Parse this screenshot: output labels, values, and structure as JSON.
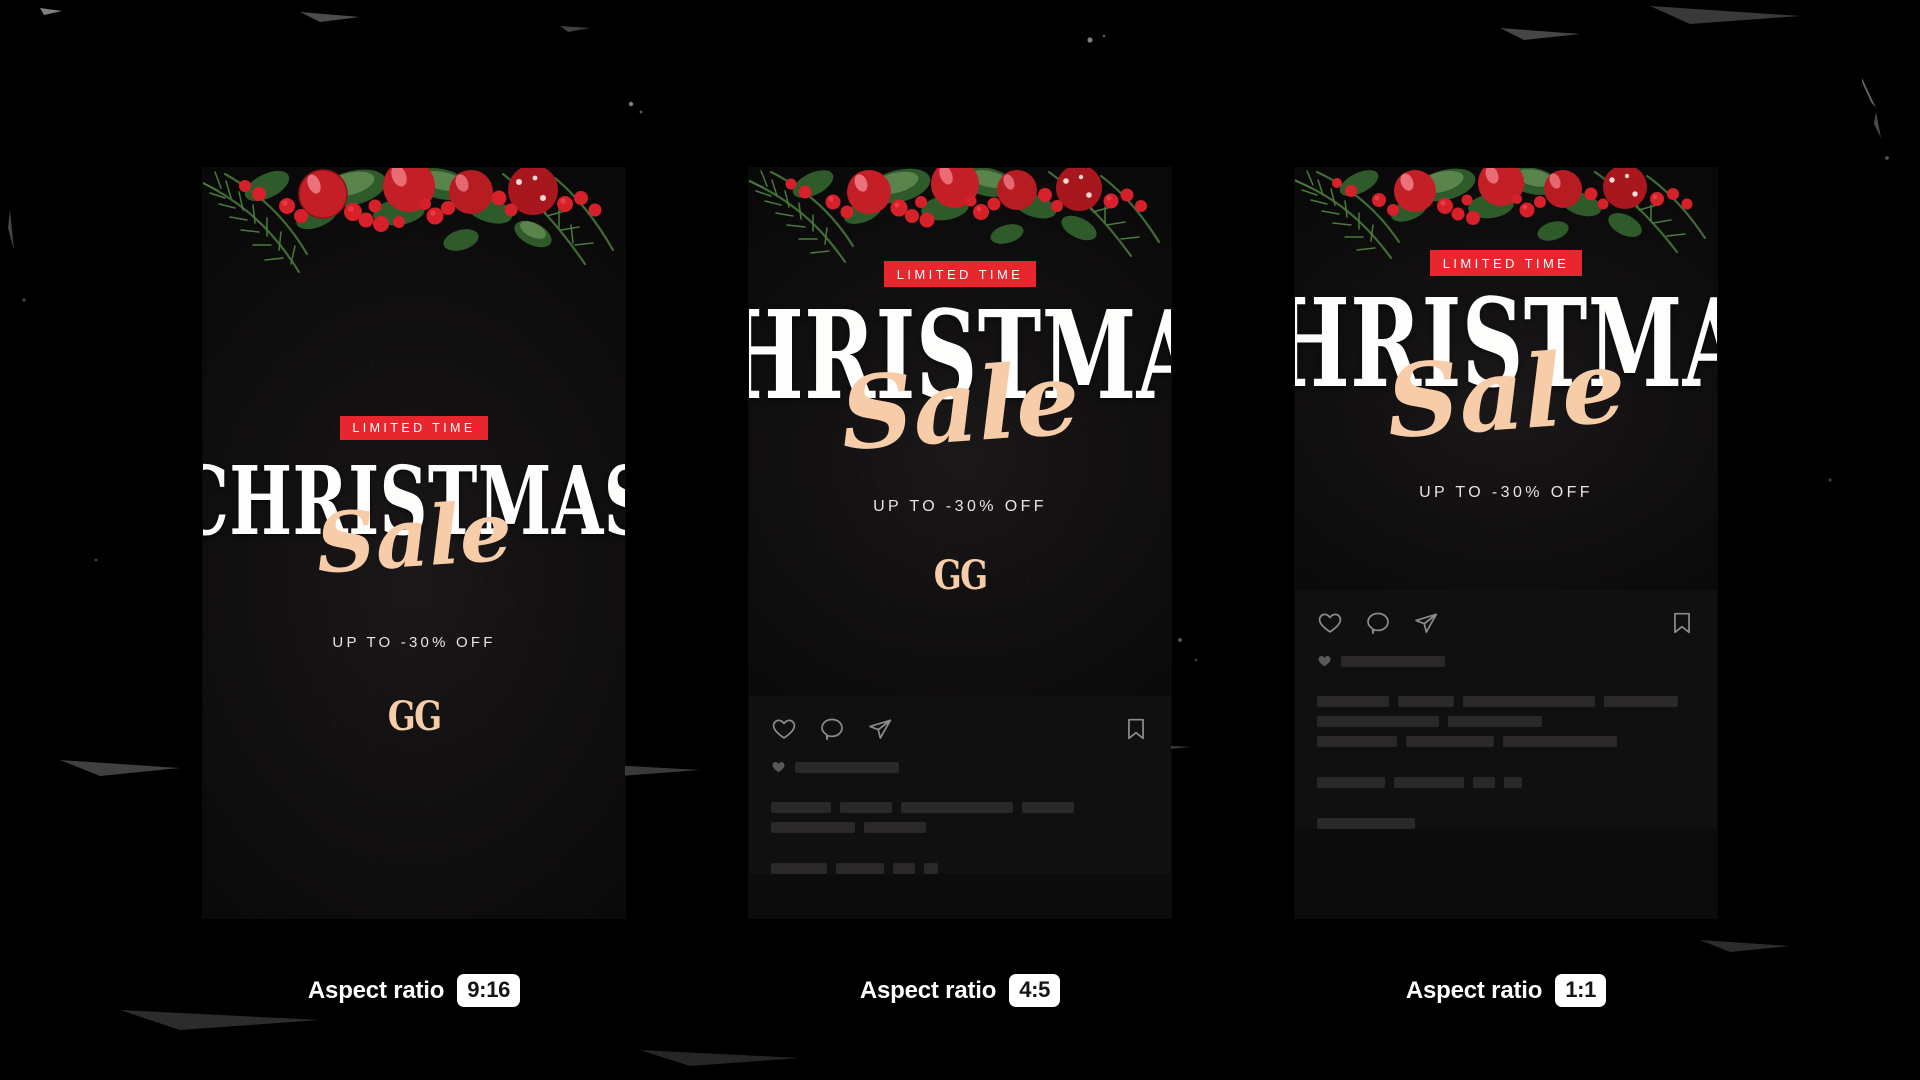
{
  "page": {
    "background_color": "#000000",
    "accent_red": "#e8262e",
    "accent_cream": "#f6cda8",
    "card_background": "#0d0c0c",
    "feed_background": "#111010",
    "skeleton_color": "#2a2828"
  },
  "creative": {
    "badge": "LIMITED TIME",
    "headline": "CHRISTMAS",
    "script": "Sale",
    "subline": "UP TO -30% OFF",
    "logo": "GG"
  },
  "icons": {
    "like": "heart-icon",
    "comment": "comment-icon",
    "share": "send-icon",
    "save": "bookmark-icon",
    "liked_by": "heart-filled-icon"
  },
  "previews": [
    {
      "id": "preview-9-16",
      "ratio_label": "Aspect ratio",
      "ratio_value": "9:16",
      "shows_feed": false
    },
    {
      "id": "preview-4-5",
      "ratio_label": "Aspect ratio",
      "ratio_value": "4:5",
      "shows_feed": true
    },
    {
      "id": "preview-1-1",
      "ratio_label": "Aspect ratio",
      "ratio_value": "1:1",
      "shows_feed": true
    }
  ],
  "skeleton": {
    "likes_bar_width": 104,
    "rows_45": [
      [
        60,
        52,
        112,
        52
      ],
      [
        84,
        62
      ],
      [],
      [
        56,
        48,
        22,
        14
      ]
    ],
    "rows_11": [
      [
        72,
        56,
        132,
        74
      ],
      [
        122,
        94
      ],
      [
        80,
        88,
        114
      ],
      [
        68,
        70,
        22,
        18
      ],
      [
        98
      ]
    ]
  }
}
